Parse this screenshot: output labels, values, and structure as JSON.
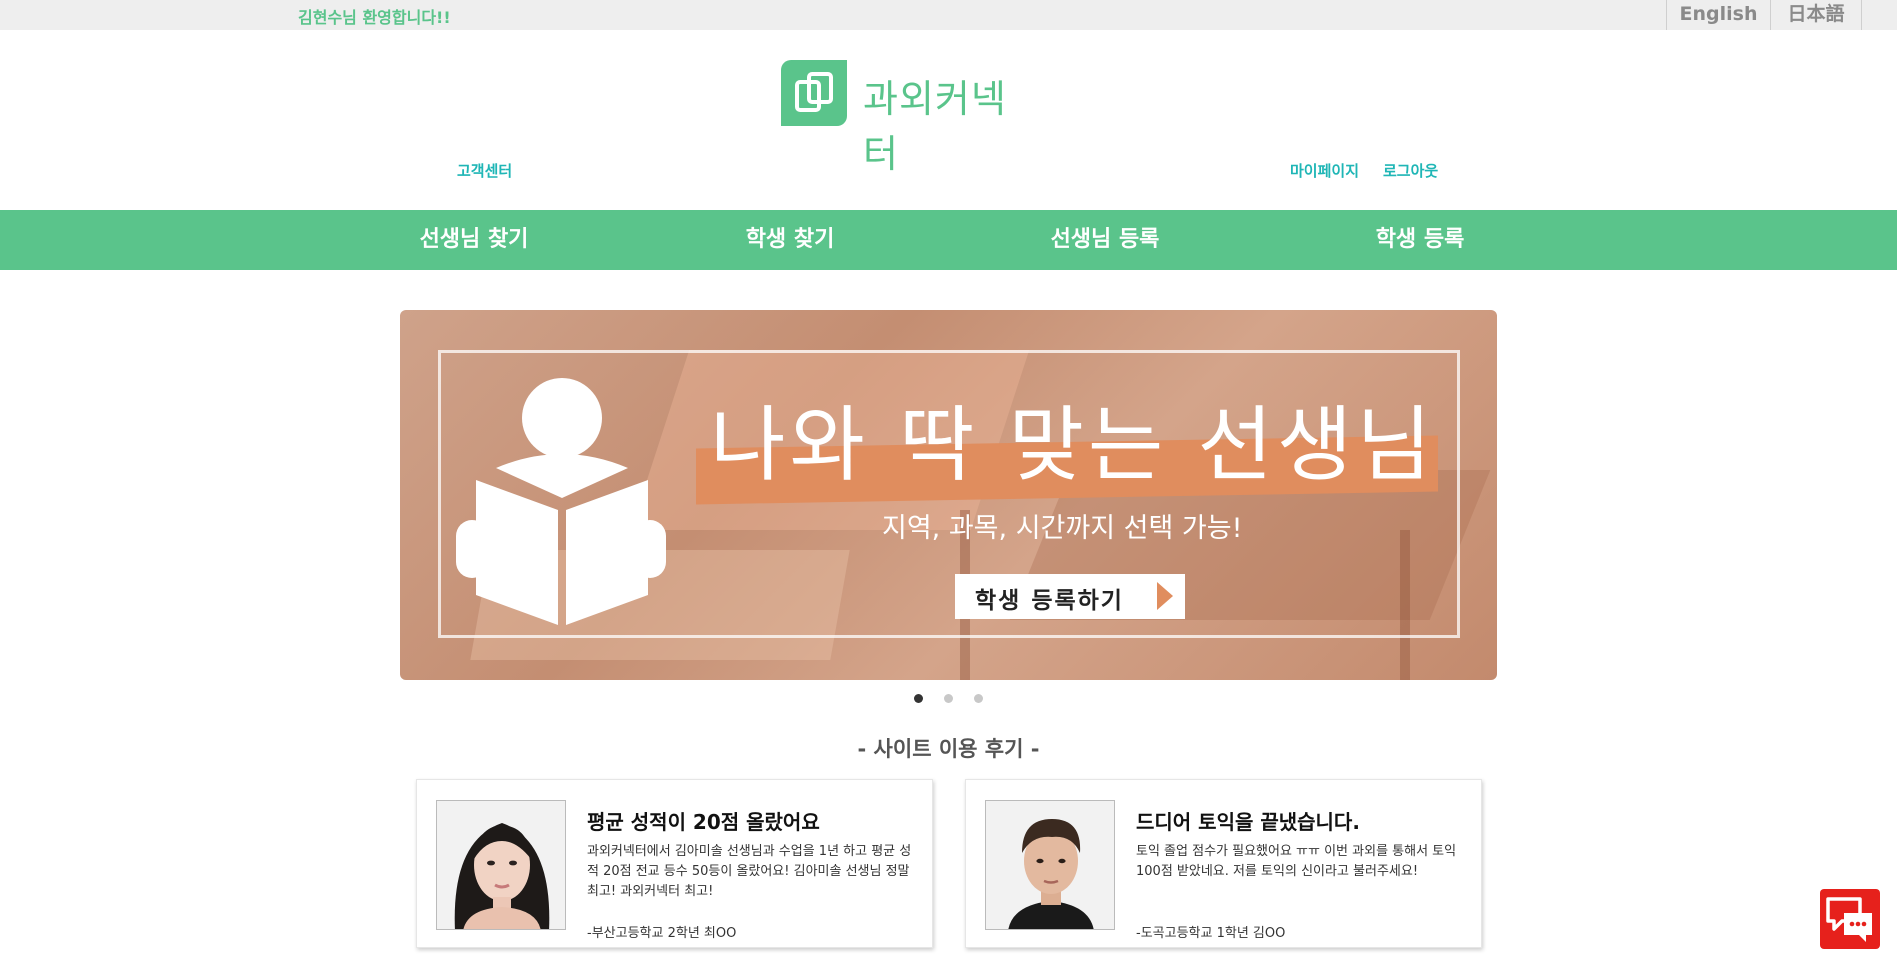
{
  "topbar": {
    "welcome": "김현수님 환영합니다!!",
    "languages": [
      "English",
      "日本語"
    ]
  },
  "logo": {
    "text": "과외커넥터"
  },
  "util_links": {
    "customer_center": "고객센터",
    "mypage": "마이페이지",
    "logout": "로그아웃"
  },
  "nav": {
    "items": [
      "선생님 찾기",
      "학생 찾기",
      "선생님 등록",
      "학생 등록"
    ]
  },
  "banner": {
    "headline": "나와 딱 맞는 선생님",
    "subline": "지역, 과목, 시간까지 선택 가능!",
    "cta": "학생 등록하기",
    "slides": 3,
    "active_slide": 1
  },
  "reviews": {
    "title": "- 사이트 이용 후기 -",
    "items": [
      {
        "title": "평균 성적이 20점 올랐어요",
        "body": "과외커넥터에서 김아미솔 선생님과 수업을 1년 하고 평균 성적 20점 전교 등수 50등이 올랐어요! 김아미솔 선생님 정말 최고! 과외커넥터 최고!",
        "author": "-부산고등학교 2학년 최OO"
      },
      {
        "title": "드디어 토익을 끝냈습니다.",
        "body": "토익 졸업 점수가 필요했어요 ㅠㅠ 이번 과외를 통해서 토익 100점 받았네요. 저를 토익의 신이라고 불러주세요!",
        "author": "-도곡고등학교 1학년 김OO"
      }
    ]
  },
  "colors": {
    "brand_green": "#5ac48b",
    "link_teal": "#1fb6b6",
    "banner_accent": "#e08d5e",
    "chat_red": "#e6211c"
  }
}
